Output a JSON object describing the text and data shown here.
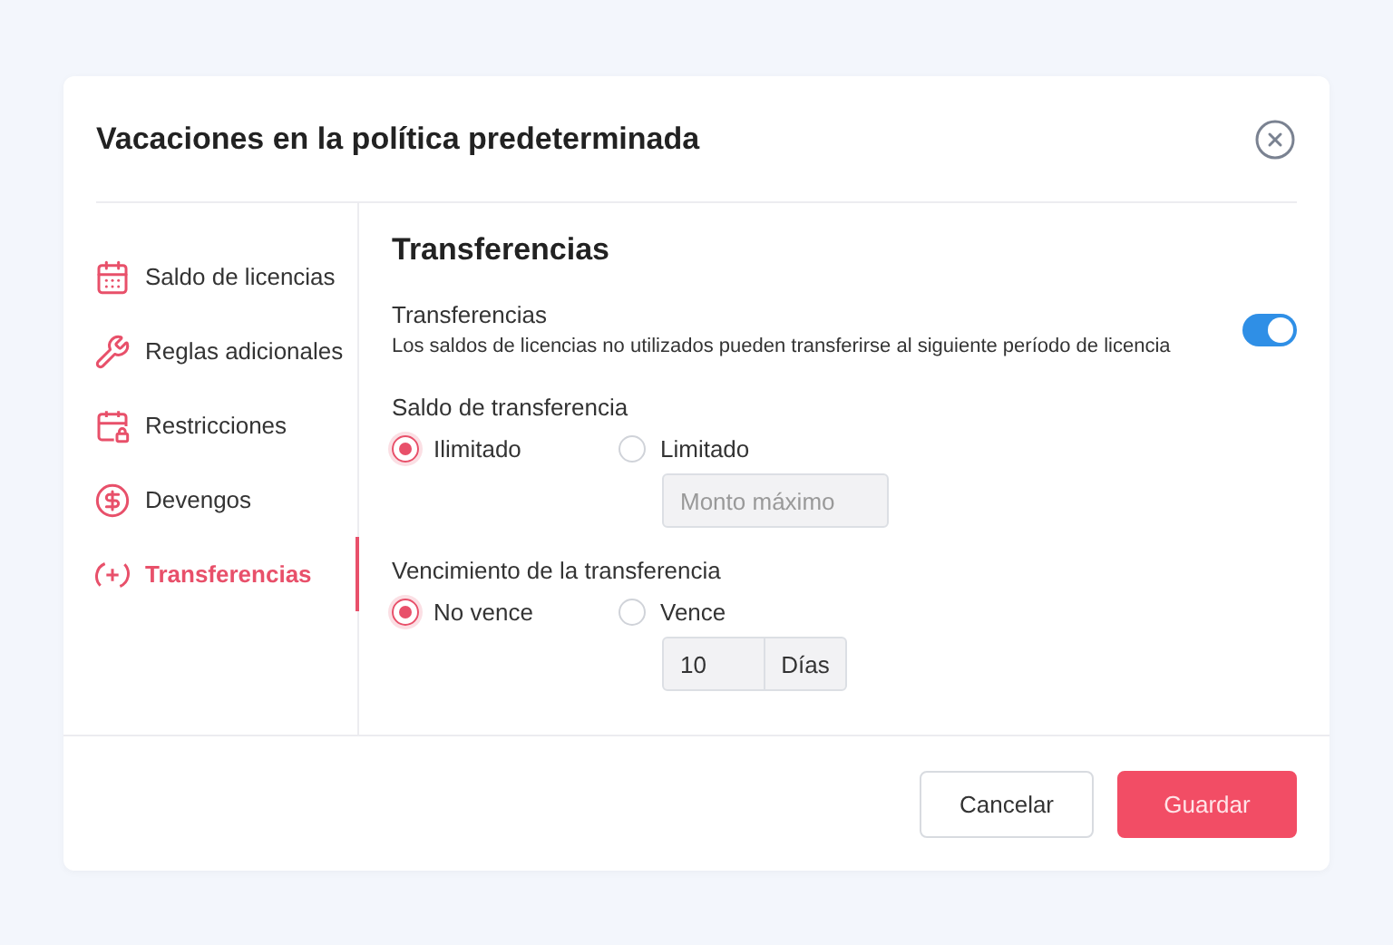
{
  "dialog": {
    "title": "Vacaciones en la política predeterminada"
  },
  "sidebar": {
    "items": [
      {
        "label": "Saldo de licencias",
        "selected": false
      },
      {
        "label": "Reglas adicionales",
        "selected": false
      },
      {
        "label": "Restricciones",
        "selected": false
      },
      {
        "label": "Devengos",
        "selected": false
      },
      {
        "label": "Transferencias",
        "selected": true
      }
    ]
  },
  "content": {
    "heading": "Transferencias",
    "toggle": {
      "label": "Transferencias",
      "description": "Los saldos de licencias no utilizados pueden transferirse al siguiente período de licencia",
      "on": true
    },
    "groups": [
      {
        "label": "Saldo de transferencia",
        "options": [
          {
            "label": "Ilimitado",
            "selected": true
          },
          {
            "label": "Limitado",
            "selected": false,
            "field": {
              "placeholder": "Monto máximo"
            }
          }
        ]
      },
      {
        "label": "Vencimiento de la transferencia",
        "options": [
          {
            "label": "No vence",
            "selected": true
          },
          {
            "label": "Vence",
            "selected": false,
            "field": {
              "value": "10",
              "suffix": "Días"
            }
          }
        ]
      }
    ]
  },
  "footer": {
    "buttons": [
      {
        "label": "Cancelar",
        "kind": "secondary"
      },
      {
        "label": "Guardar",
        "kind": "primary"
      }
    ]
  }
}
